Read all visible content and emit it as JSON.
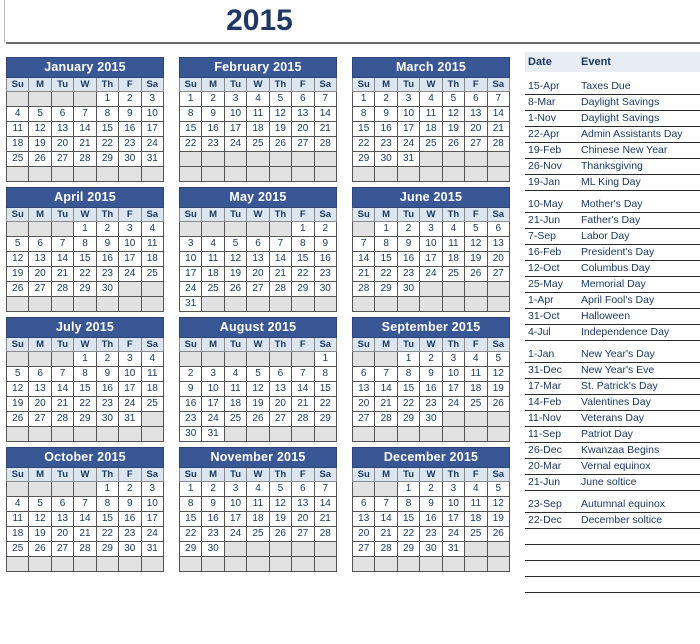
{
  "title": "2015",
  "weekdays": [
    "Su",
    "M",
    "Tu",
    "W",
    "Th",
    "F",
    "Sa"
  ],
  "colors": {
    "month_header_bg": "#3A5795",
    "month_header_text": "#FFFFFF",
    "weekday_bg": "#DCE6F1",
    "day_text": "#17375E",
    "empty_cell_bg": "#E2E2E2",
    "title_text": "#1F3864",
    "events_header_bg": "#E8EDF5"
  },
  "months": [
    {
      "name": "January 2015",
      "weeks": [
        [
          "",
          "",
          "",
          "",
          "1",
          "2",
          "3"
        ],
        [
          "4",
          "5",
          "6",
          "7",
          "8",
          "9",
          "10"
        ],
        [
          "11",
          "12",
          "13",
          "14",
          "15",
          "16",
          "17"
        ],
        [
          "18",
          "19",
          "20",
          "21",
          "22",
          "23",
          "24"
        ],
        [
          "25",
          "26",
          "27",
          "28",
          "29",
          "30",
          "31"
        ],
        [
          "",
          "",
          "",
          "",
          "",
          "",
          ""
        ]
      ]
    },
    {
      "name": "February 2015",
      "weeks": [
        [
          "1",
          "2",
          "3",
          "4",
          "5",
          "6",
          "7"
        ],
        [
          "8",
          "9",
          "10",
          "11",
          "12",
          "13",
          "14"
        ],
        [
          "15",
          "16",
          "17",
          "18",
          "19",
          "20",
          "21"
        ],
        [
          "22",
          "23",
          "24",
          "25",
          "26",
          "27",
          "28"
        ],
        [
          "",
          "",
          "",
          "",
          "",
          "",
          ""
        ],
        [
          "",
          "",
          "",
          "",
          "",
          "",
          ""
        ]
      ]
    },
    {
      "name": "March 2015",
      "weeks": [
        [
          "1",
          "2",
          "3",
          "4",
          "5",
          "6",
          "7"
        ],
        [
          "8",
          "9",
          "10",
          "11",
          "12",
          "13",
          "14"
        ],
        [
          "15",
          "16",
          "17",
          "18",
          "19",
          "20",
          "21"
        ],
        [
          "22",
          "23",
          "24",
          "25",
          "26",
          "27",
          "28"
        ],
        [
          "29",
          "30",
          "31",
          "",
          "",
          "",
          ""
        ],
        [
          "",
          "",
          "",
          "",
          "",
          "",
          ""
        ]
      ]
    },
    {
      "name": "April 2015",
      "weeks": [
        [
          "",
          "",
          "",
          "1",
          "2",
          "3",
          "4"
        ],
        [
          "5",
          "6",
          "7",
          "8",
          "9",
          "10",
          "11"
        ],
        [
          "12",
          "13",
          "14",
          "15",
          "16",
          "17",
          "18"
        ],
        [
          "19",
          "20",
          "21",
          "22",
          "23",
          "24",
          "25"
        ],
        [
          "26",
          "27",
          "28",
          "29",
          "30",
          "",
          ""
        ],
        [
          "",
          "",
          "",
          "",
          "",
          "",
          ""
        ]
      ]
    },
    {
      "name": "May 2015",
      "weeks": [
        [
          "",
          "",
          "",
          "",
          "",
          "1",
          "2"
        ],
        [
          "3",
          "4",
          "5",
          "6",
          "7",
          "8",
          "9"
        ],
        [
          "10",
          "11",
          "12",
          "13",
          "14",
          "15",
          "16"
        ],
        [
          "17",
          "18",
          "19",
          "20",
          "21",
          "22",
          "23"
        ],
        [
          "24",
          "25",
          "26",
          "27",
          "28",
          "29",
          "30"
        ],
        [
          "31",
          "",
          "",
          "",
          "",
          "",
          ""
        ]
      ]
    },
    {
      "name": "June 2015",
      "weeks": [
        [
          "",
          "1",
          "2",
          "3",
          "4",
          "5",
          "6"
        ],
        [
          "7",
          "8",
          "9",
          "10",
          "11",
          "12",
          "13"
        ],
        [
          "14",
          "15",
          "16",
          "17",
          "18",
          "19",
          "20"
        ],
        [
          "21",
          "22",
          "23",
          "24",
          "25",
          "26",
          "27"
        ],
        [
          "28",
          "29",
          "30",
          "",
          "",
          "",
          ""
        ],
        [
          "",
          "",
          "",
          "",
          "",
          "",
          ""
        ]
      ]
    },
    {
      "name": "July 2015",
      "weeks": [
        [
          "",
          "",
          "",
          "1",
          "2",
          "3",
          "4"
        ],
        [
          "5",
          "6",
          "7",
          "8",
          "9",
          "10",
          "11"
        ],
        [
          "12",
          "13",
          "14",
          "15",
          "16",
          "17",
          "18"
        ],
        [
          "19",
          "20",
          "21",
          "22",
          "23",
          "24",
          "25"
        ],
        [
          "26",
          "27",
          "28",
          "29",
          "30",
          "31",
          ""
        ],
        [
          "",
          "",
          "",
          "",
          "",
          "",
          ""
        ]
      ]
    },
    {
      "name": "August 2015",
      "weeks": [
        [
          "",
          "",
          "",
          "",
          "",
          "",
          "1"
        ],
        [
          "2",
          "3",
          "4",
          "5",
          "6",
          "7",
          "8"
        ],
        [
          "9",
          "10",
          "11",
          "12",
          "13",
          "14",
          "15"
        ],
        [
          "16",
          "17",
          "18",
          "19",
          "20",
          "21",
          "22"
        ],
        [
          "23",
          "24",
          "25",
          "26",
          "27",
          "28",
          "29"
        ],
        [
          "30",
          "31",
          "",
          "",
          "",
          "",
          ""
        ]
      ]
    },
    {
      "name": "September 2015",
      "weeks": [
        [
          "",
          "",
          "1",
          "2",
          "3",
          "4",
          "5"
        ],
        [
          "6",
          "7",
          "8",
          "9",
          "10",
          "11",
          "12"
        ],
        [
          "13",
          "14",
          "15",
          "16",
          "17",
          "18",
          "19"
        ],
        [
          "20",
          "21",
          "22",
          "23",
          "24",
          "25",
          "26"
        ],
        [
          "27",
          "28",
          "29",
          "30",
          "",
          "",
          ""
        ],
        [
          "",
          "",
          "",
          "",
          "",
          "",
          ""
        ]
      ]
    },
    {
      "name": "October 2015",
      "weeks": [
        [
          "",
          "",
          "",
          "",
          "1",
          "2",
          "3"
        ],
        [
          "4",
          "5",
          "6",
          "7",
          "8",
          "9",
          "10"
        ],
        [
          "11",
          "12",
          "13",
          "14",
          "15",
          "16",
          "17"
        ],
        [
          "18",
          "19",
          "20",
          "21",
          "22",
          "23",
          "24"
        ],
        [
          "25",
          "26",
          "27",
          "28",
          "29",
          "30",
          "31"
        ],
        [
          "",
          "",
          "",
          "",
          "",
          "",
          ""
        ]
      ]
    },
    {
      "name": "November 2015",
      "weeks": [
        [
          "1",
          "2",
          "3",
          "4",
          "5",
          "6",
          "7"
        ],
        [
          "8",
          "9",
          "10",
          "11",
          "12",
          "13",
          "14"
        ],
        [
          "15",
          "16",
          "17",
          "18",
          "19",
          "20",
          "21"
        ],
        [
          "22",
          "23",
          "24",
          "25",
          "26",
          "27",
          "28"
        ],
        [
          "29",
          "30",
          "",
          "",
          "",
          "",
          ""
        ],
        [
          "",
          "",
          "",
          "",
          "",
          "",
          ""
        ]
      ]
    },
    {
      "name": "December 2015",
      "weeks": [
        [
          "",
          "",
          "1",
          "2",
          "3",
          "4",
          "5"
        ],
        [
          "6",
          "7",
          "8",
          "9",
          "10",
          "11",
          "12"
        ],
        [
          "13",
          "14",
          "15",
          "16",
          "17",
          "18",
          "19"
        ],
        [
          "20",
          "21",
          "22",
          "23",
          "24",
          "25",
          "26"
        ],
        [
          "27",
          "28",
          "29",
          "30",
          "31",
          "",
          ""
        ],
        [
          "",
          "",
          "",
          "",
          "",
          "",
          ""
        ]
      ]
    }
  ],
  "events": {
    "header": {
      "date": "Date",
      "event": "Event"
    },
    "rows": [
      {
        "type": "spacer",
        "date": "",
        "event": ""
      },
      {
        "type": "event",
        "date": "15-Apr",
        "event": "Taxes Due"
      },
      {
        "type": "event",
        "date": "8-Mar",
        "event": "Daylight Savings"
      },
      {
        "type": "event",
        "date": "1-Nov",
        "event": "Daylight Savings"
      },
      {
        "type": "event",
        "date": "22-Apr",
        "event": "Admin Assistants Day"
      },
      {
        "type": "event",
        "date": "19-Feb",
        "event": "Chinese New Year"
      },
      {
        "type": "event",
        "date": "26-Nov",
        "event": "Thanksgiving"
      },
      {
        "type": "event",
        "date": "19-Jan",
        "event": "ML King Day"
      },
      {
        "type": "gap",
        "date": "",
        "event": ""
      },
      {
        "type": "event",
        "date": "10-May",
        "event": "Mother's Day"
      },
      {
        "type": "event",
        "date": "21-Jun",
        "event": "Father's Day"
      },
      {
        "type": "event",
        "date": "7-Sep",
        "event": "Labor Day"
      },
      {
        "type": "event",
        "date": "16-Feb",
        "event": "President's Day"
      },
      {
        "type": "event",
        "date": "12-Oct",
        "event": "Columbus Day"
      },
      {
        "type": "event",
        "date": "25-May",
        "event": "Memorial Day"
      },
      {
        "type": "event",
        "date": "1-Apr",
        "event": "April Fool's Day"
      },
      {
        "type": "event",
        "date": "31-Oct",
        "event": "Halloween"
      },
      {
        "type": "event",
        "date": "4-Jul",
        "event": "Independence Day"
      },
      {
        "type": "gap",
        "date": "",
        "event": ""
      },
      {
        "type": "event",
        "date": "1-Jan",
        "event": "New Year's Day"
      },
      {
        "type": "event",
        "date": "31-Dec",
        "event": "New Year's Eve"
      },
      {
        "type": "event",
        "date": "17-Mar",
        "event": "St. Patrick's Day"
      },
      {
        "type": "event",
        "date": "14-Feb",
        "event": "Valentines Day"
      },
      {
        "type": "event",
        "date": "11-Nov",
        "event": "Veterans Day"
      },
      {
        "type": "event",
        "date": "11-Sep",
        "event": "Patriot Day"
      },
      {
        "type": "event",
        "date": "26-Dec",
        "event": "Kwanzaa Begins"
      },
      {
        "type": "event",
        "date": "20-Mar",
        "event": "Vernal equinox"
      },
      {
        "type": "event",
        "date": "21-Jun",
        "event": "June soltice"
      },
      {
        "type": "gap",
        "date": "",
        "event": ""
      },
      {
        "type": "event",
        "date": "23-Sep",
        "event": "Autumnal equinox"
      },
      {
        "type": "event",
        "date": "22-Dec",
        "event": "December soltice"
      },
      {
        "type": "blank",
        "date": "",
        "event": ""
      },
      {
        "type": "blank",
        "date": "",
        "event": ""
      },
      {
        "type": "blank",
        "date": "",
        "event": ""
      },
      {
        "type": "blank",
        "date": "",
        "event": ""
      }
    ]
  }
}
